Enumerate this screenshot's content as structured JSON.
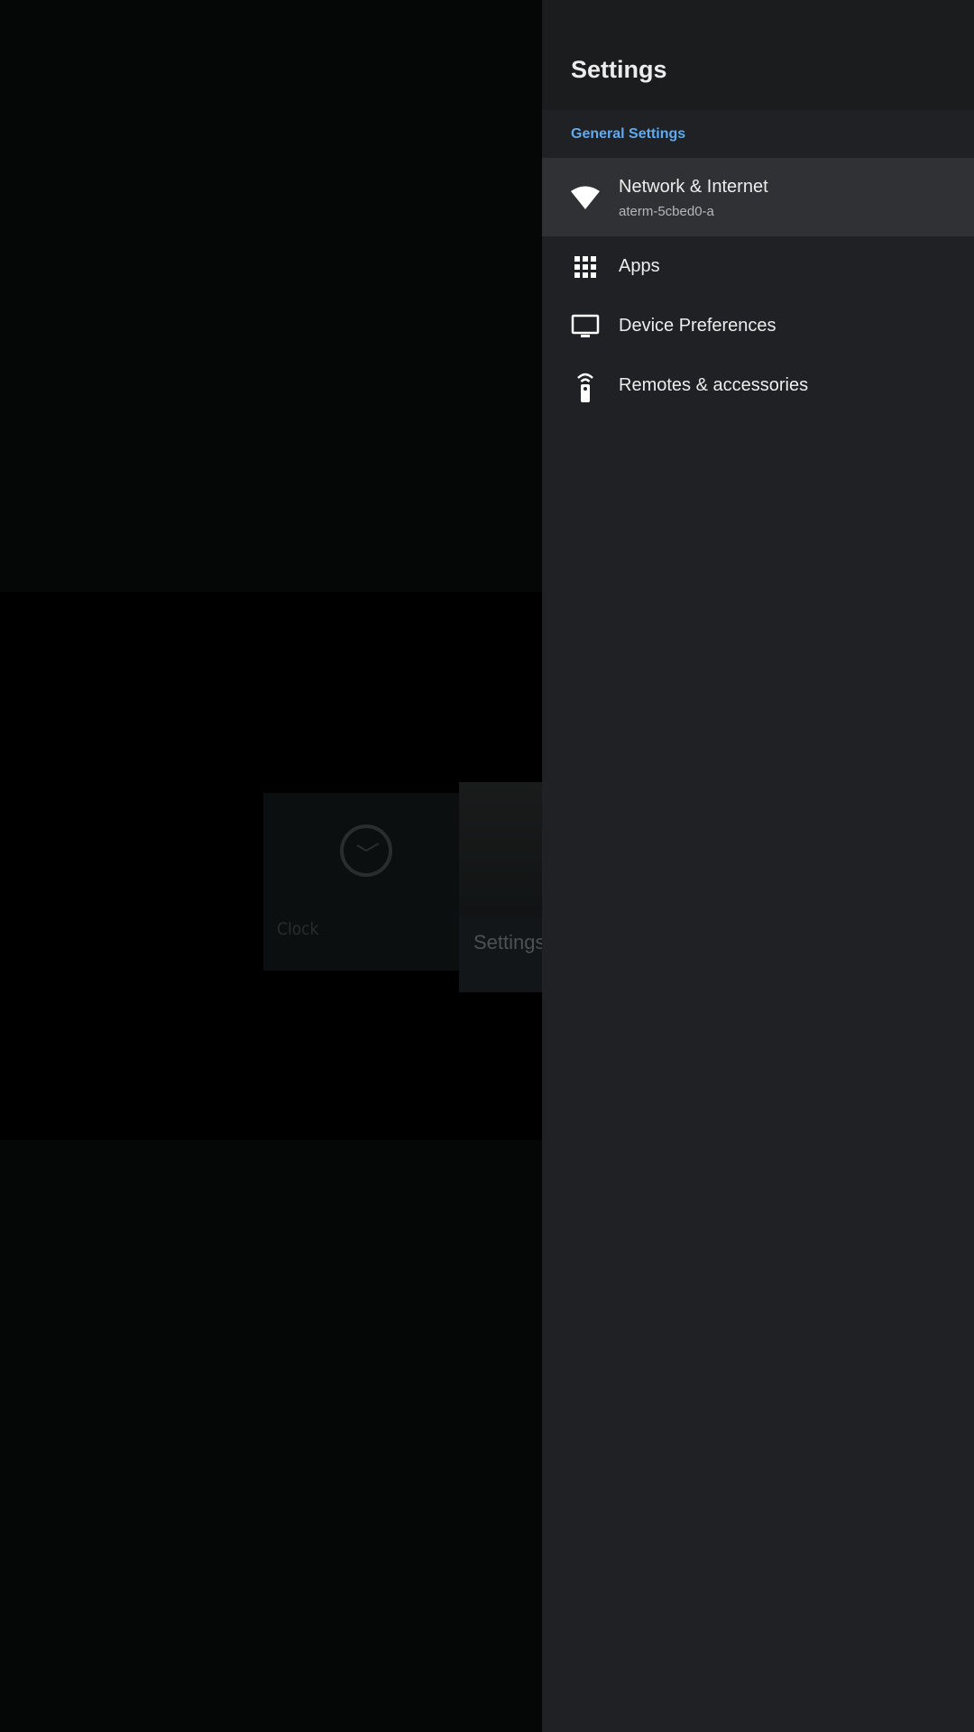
{
  "launcher": {
    "tiles": [
      {
        "label": "Clock",
        "icon": "clock-icon"
      },
      {
        "label": "Settings"
      }
    ]
  },
  "settings_panel": {
    "title": "Settings",
    "section": "General Settings",
    "items": [
      {
        "label": "Network & Internet",
        "sublabel": "aterm-5cbed0-a",
        "icon": "wifi-icon",
        "selected": true
      },
      {
        "label": "Apps",
        "icon": "apps-grid-icon"
      },
      {
        "label": "Device Preferences",
        "icon": "tv-icon"
      },
      {
        "label": "Remotes & accessories",
        "icon": "remote-icon"
      }
    ]
  },
  "colors": {
    "accent": "#5eabf2",
    "panel_background": "#202124",
    "selected_row": "#303134"
  }
}
